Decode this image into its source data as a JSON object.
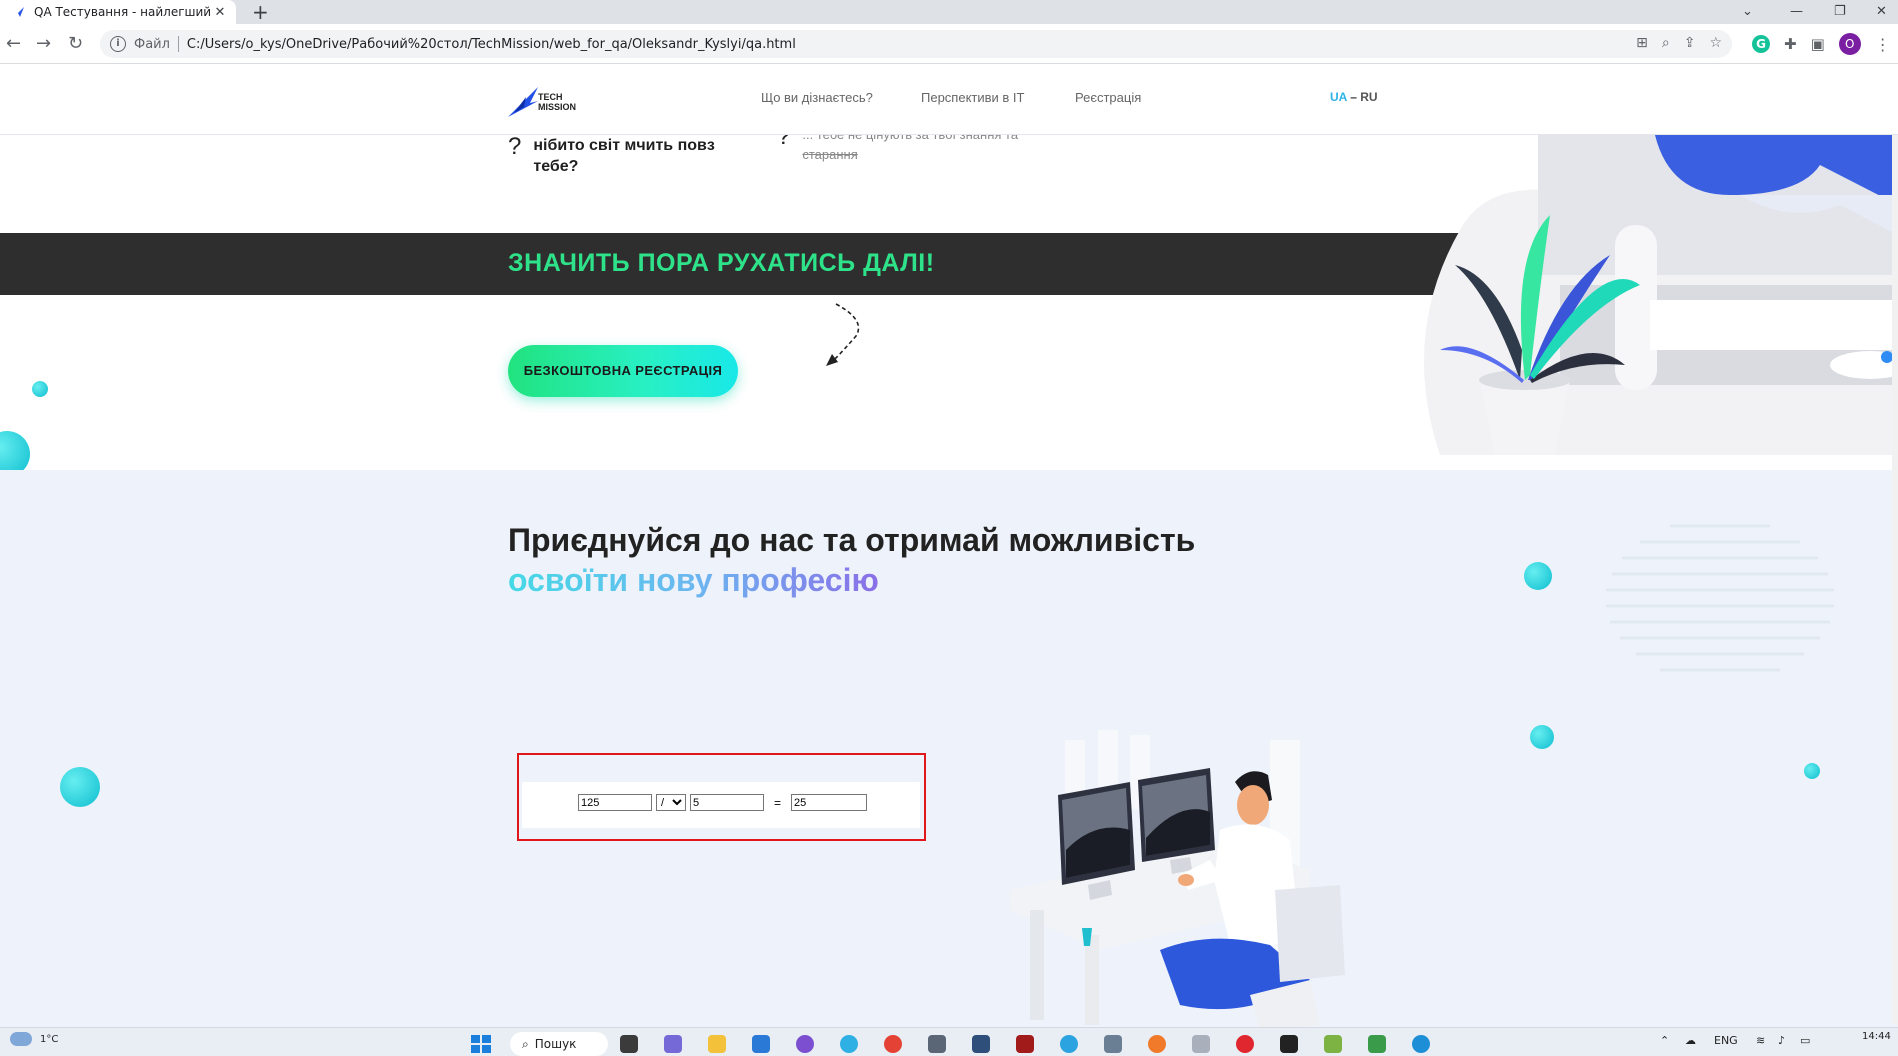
{
  "browser": {
    "tab_title": "QA Тестування - найлегший ста",
    "new_tab": "+",
    "close_tab": "✕",
    "omnibox_label": "Файл",
    "url": "C:/Users/o_kys/OneDrive/Рабочий%20стол/TechMission/web_for_qa/Oleksandr_Kyslyi/qa.html",
    "profile_initial": "O",
    "grammarly_initial": "G"
  },
  "site": {
    "logo_line1": "TECH",
    "logo_line2": "MISSION",
    "nav": [
      "Що ви дізнаєтесь?",
      "Перспективи в IT",
      "Реєстрація"
    ],
    "lang_ua": "UA",
    "lang_sep": "–",
    "lang_ru": "RU",
    "question_mark": "?",
    "q1_text": "нібито світ мчить повз тебе?",
    "q2_text": "... тебе не цінують за твої знання та старання",
    "band_text": "ЗНАЧИТЬ ПОРА РУХАТИСЬ ДАЛІ!",
    "cta_label": "БЕЗКОШТОВНА РЕЄСТРАЦІЯ",
    "heading_part1": "Приєднуйся до нас та отримай можливість",
    "heading_highlight": "освоїти нову професію"
  },
  "calculator": {
    "operand1": "125",
    "operator": "/",
    "operators": [
      "+",
      "-",
      "*",
      "/"
    ],
    "operand2": "5",
    "equals": "=",
    "result": "25"
  },
  "taskbar": {
    "temperature": "1°C",
    "search_label": "Пошук",
    "lang": "ENG",
    "time": "14:44"
  },
  "colors": {
    "accent_green": "#2ee28a",
    "accent_cyan": "#1fc7d6",
    "highlight_frame": "#e0181b",
    "dark_band": "#2e2e2e"
  }
}
